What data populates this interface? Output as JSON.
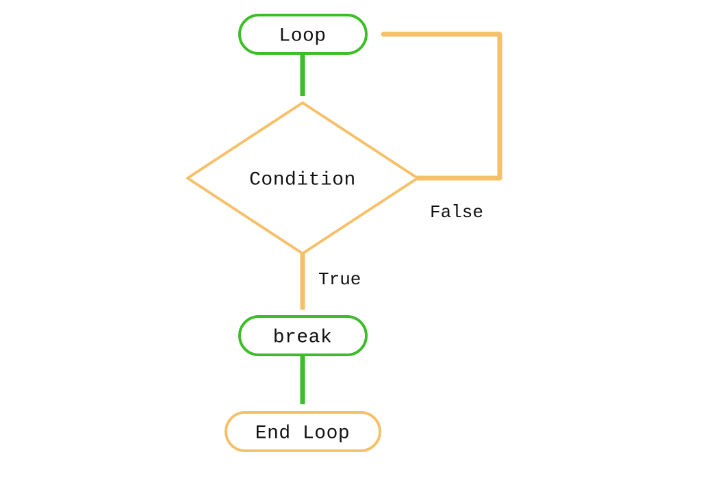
{
  "colors": {
    "green": "#3BBE27",
    "amber": "#F6C069",
    "text": "#111111"
  },
  "nodes": {
    "loop": {
      "label": "Loop"
    },
    "condition": {
      "label": "Condition"
    },
    "break": {
      "label": "break"
    },
    "end": {
      "label": "End Loop"
    }
  },
  "edges": {
    "loop_to_condition": {
      "label": ""
    },
    "condition_true": {
      "label": "True"
    },
    "condition_false": {
      "label": "False"
    },
    "break_to_end": {
      "label": ""
    }
  }
}
